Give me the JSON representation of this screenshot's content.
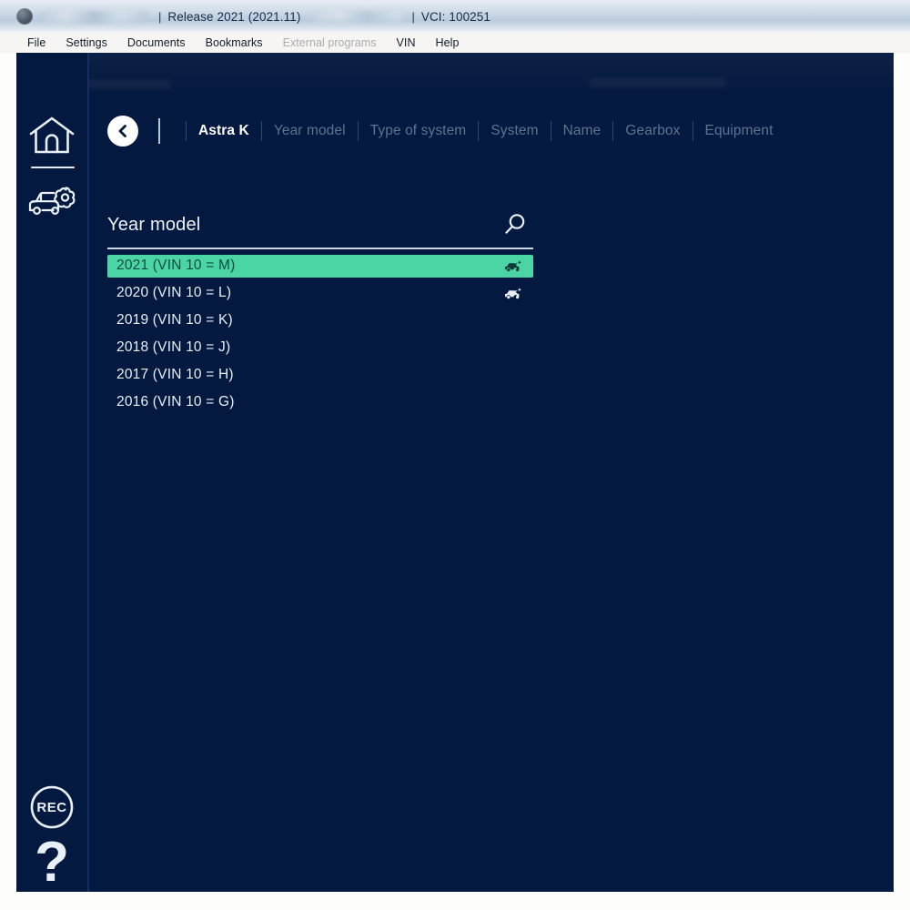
{
  "window": {
    "title_separator": "|",
    "release": "Release 2021 (2021.11)",
    "vci": "VCI: 100251"
  },
  "menu": {
    "items": [
      {
        "label": "File",
        "disabled": false
      },
      {
        "label": "Settings",
        "disabled": false
      },
      {
        "label": "Documents",
        "disabled": false
      },
      {
        "label": "Bookmarks",
        "disabled": false
      },
      {
        "label": "External programs",
        "disabled": true
      },
      {
        "label": "VIN",
        "disabled": false
      },
      {
        "label": "Help",
        "disabled": false
      }
    ]
  },
  "sidebar": {
    "items": [
      {
        "name": "home",
        "icon": "home-icon",
        "label": "Home"
      },
      {
        "name": "vehicle",
        "icon": "car-settings-icon",
        "label": "Vehicle"
      },
      {
        "name": "record",
        "icon": "rec-icon",
        "label": "REC"
      },
      {
        "name": "help",
        "icon": "question-mark-icon",
        "label": "?"
      }
    ],
    "rec_label": "REC",
    "help_label": "?"
  },
  "breadcrumb": {
    "back_label": "Back",
    "items": [
      {
        "label": "Astra K",
        "active": true
      },
      {
        "label": "Year model",
        "active": false
      },
      {
        "label": "Type of system",
        "active": false
      },
      {
        "label": "System",
        "active": false
      },
      {
        "label": "Name",
        "active": false
      },
      {
        "label": "Gearbox",
        "active": false
      },
      {
        "label": "Equipment",
        "active": false
      }
    ]
  },
  "list": {
    "title": "Year model",
    "search_icon": "search-icon",
    "rows": [
      {
        "label": "2021 (VIN 10 = M)",
        "selected": true,
        "icon": "car-new-icon"
      },
      {
        "label": "2020 (VIN 10 = L)",
        "selected": false,
        "icon": "car-new-icon"
      },
      {
        "label": "2019 (VIN 10 = K)",
        "selected": false,
        "icon": ""
      },
      {
        "label": "2018 (VIN 10 = J)",
        "selected": false,
        "icon": ""
      },
      {
        "label": "2017 (VIN 10 = H)",
        "selected": false,
        "icon": ""
      },
      {
        "label": "2016 (VIN 10 = G)",
        "selected": false,
        "icon": ""
      }
    ]
  },
  "colors": {
    "background": "#04193f",
    "selection": "#4cd5a4",
    "selection_text": "#0d4b42",
    "text": "#e9eff7",
    "muted_text": "#5d7494",
    "rule": "#ccd7e6"
  }
}
